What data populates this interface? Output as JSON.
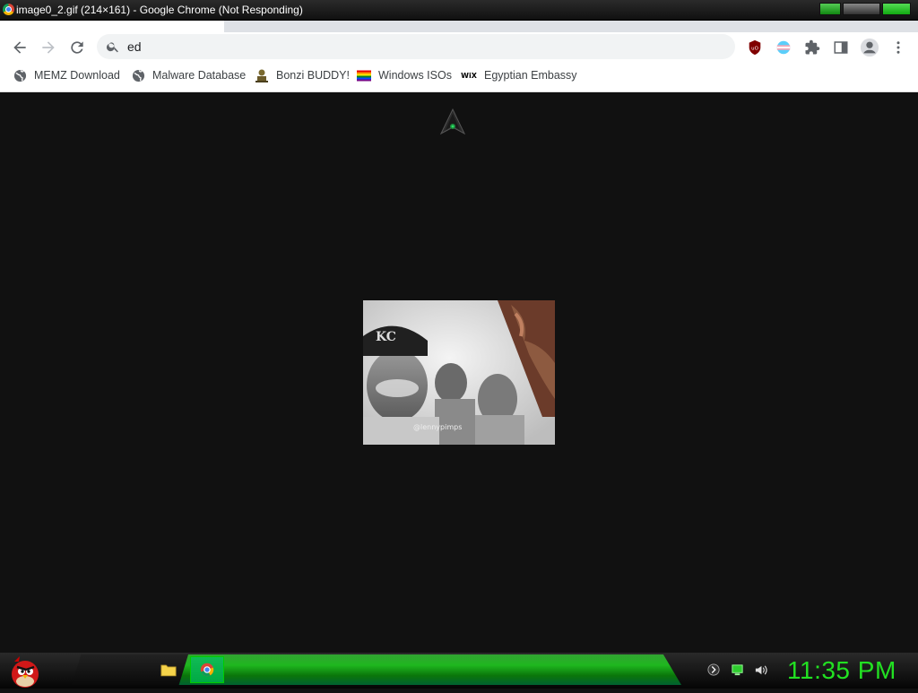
{
  "window": {
    "title": "image0_2.gif (214×161) - Google Chrome (Not Responding)"
  },
  "omnibox": {
    "value": "ed"
  },
  "bookmarks": [
    {
      "label": "MEMZ Download",
      "icon": "globe-icon"
    },
    {
      "label": "Malware Database",
      "icon": "globe-icon"
    },
    {
      "label": "Bonzi BUDDY!",
      "icon": "bonzi-icon"
    },
    {
      "label": "Windows ISOs",
      "icon": "rainbow-flag-icon"
    },
    {
      "label": "Egyptian Embassy",
      "icon": "wix-icon"
    }
  ],
  "wix_label": "WiX",
  "gif_watermark": "@lennypimps",
  "taskbar": {
    "clock": "11:35 PM"
  },
  "colors": {
    "page_bg": "#111111",
    "accent_green": "#22e022",
    "chrome_toolbar": "#ffffff"
  }
}
